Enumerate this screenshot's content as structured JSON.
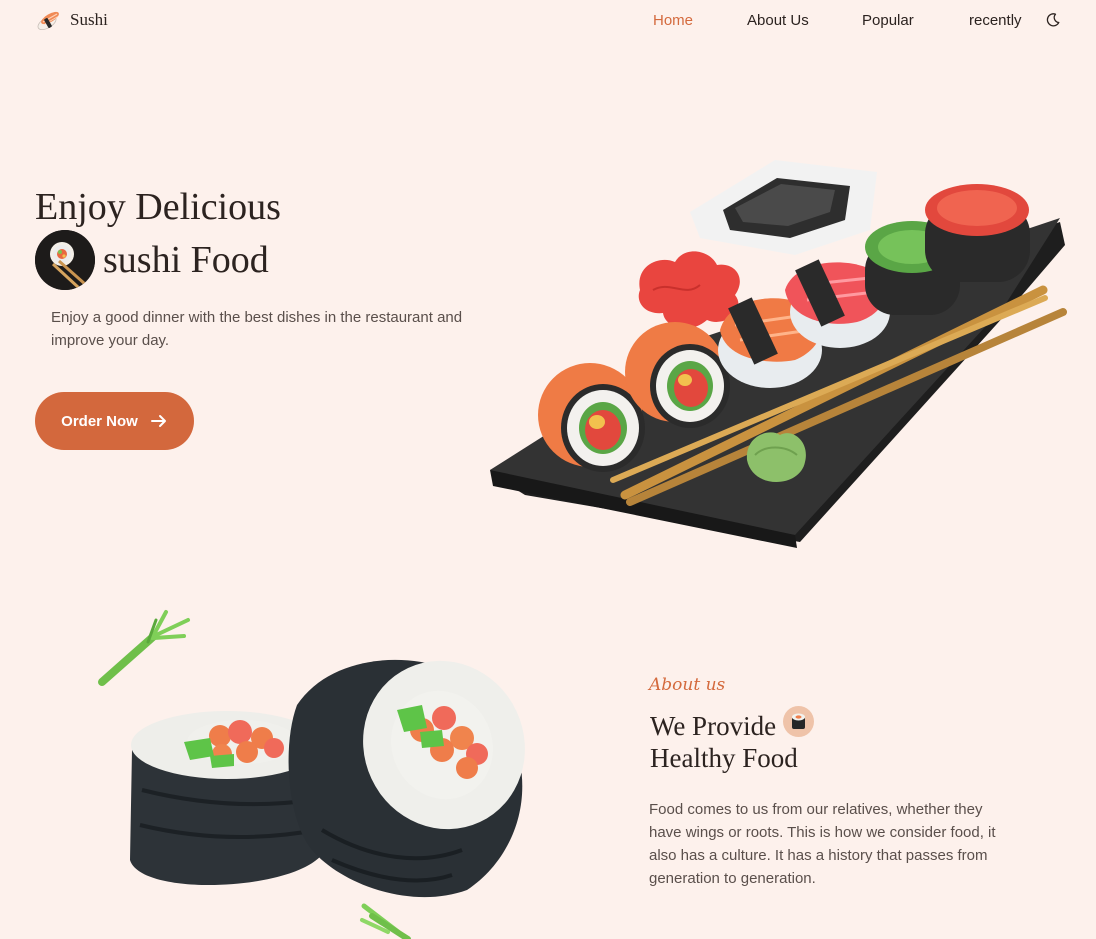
{
  "brand": {
    "name": "Sushi",
    "logo_icon": "sushi-nigiri-icon"
  },
  "nav": {
    "items": [
      {
        "label": "Home",
        "active": true
      },
      {
        "label": "About Us",
        "active": false
      },
      {
        "label": "Popular",
        "active": false
      },
      {
        "label": "recently",
        "active": false
      }
    ],
    "theme_icon": "moon-icon"
  },
  "hero": {
    "title_line1": "Enjoy Delicious",
    "title_line2": "sushi Food",
    "description": "Enjoy a good dinner with the best dishes in the restaurant and improve your day.",
    "cta_label": "Order Now",
    "cta_icon": "arrow-right-icon"
  },
  "about": {
    "tag": "About us",
    "title_line1": "We Provide",
    "title_line2": "Healthy Food",
    "description": "Food comes to us from our relatives, whether they have wings or roots. This is how we consider food, it also has a culture. It has a history that passes from generation to generation."
  },
  "colors": {
    "background": "#fdf1ec",
    "accent": "#d3683d",
    "text": "#2c2320",
    "muted_text": "#5a4f4b"
  }
}
